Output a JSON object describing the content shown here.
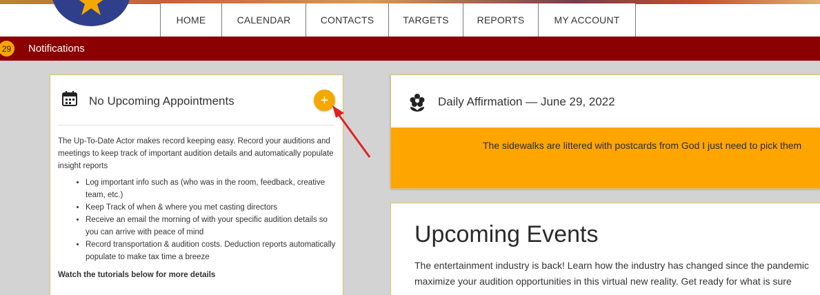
{
  "nav": {
    "items": [
      {
        "label": "HOME",
        "name": "nav-home"
      },
      {
        "label": "CALENDAR",
        "name": "nav-calendar"
      },
      {
        "label": "CONTACTS",
        "name": "nav-contacts"
      },
      {
        "label": "TARGETS",
        "name": "nav-targets"
      },
      {
        "label": "REPORTS",
        "name": "nav-reports"
      },
      {
        "label": "MY ACCOUNT",
        "name": "nav-my-account"
      }
    ]
  },
  "notifications": {
    "count": "29",
    "label": "Notifications"
  },
  "appointments": {
    "title": "No Upcoming Appointments",
    "add_label": "+",
    "intro": "The Up-To-Date Actor makes record keeping easy. Record your auditions and meetings to keep track of important audition details and automatically populate insight reports",
    "bullets": [
      "Log important info such as (who was in the room, feedback, creative team, etc.)",
      "Keep Track of when & where you met casting directors",
      "Receive an email the morning of with your specific audition details so you can arrive with peace of mind",
      "Record transportation & audition costs. Deduction reports automatically populate to make tax time a breeze"
    ],
    "footer": "Watch the tutorials below for more details"
  },
  "affirmation": {
    "title": "Daily Affirmation — June 29, 2022",
    "quote": "The sidewalks are littered with postcards from God I just need to pick them"
  },
  "events": {
    "title": "Upcoming Events",
    "line1": "The entertainment industry is back! Learn how the industry has changed since the pandemic",
    "line2": "maximize your audition opportunities in this virtual new reality. Get ready for what is sure"
  },
  "colors": {
    "notification_bar": "#8b0000",
    "accent_orange": "#ffa500",
    "add_button": "#f5a800",
    "logo_blue": "#2f3f8c",
    "annotation_arrow": "#e02020"
  },
  "icons": {
    "calendar": "calendar-icon",
    "flower": "flower-icon",
    "star": "star-icon"
  }
}
